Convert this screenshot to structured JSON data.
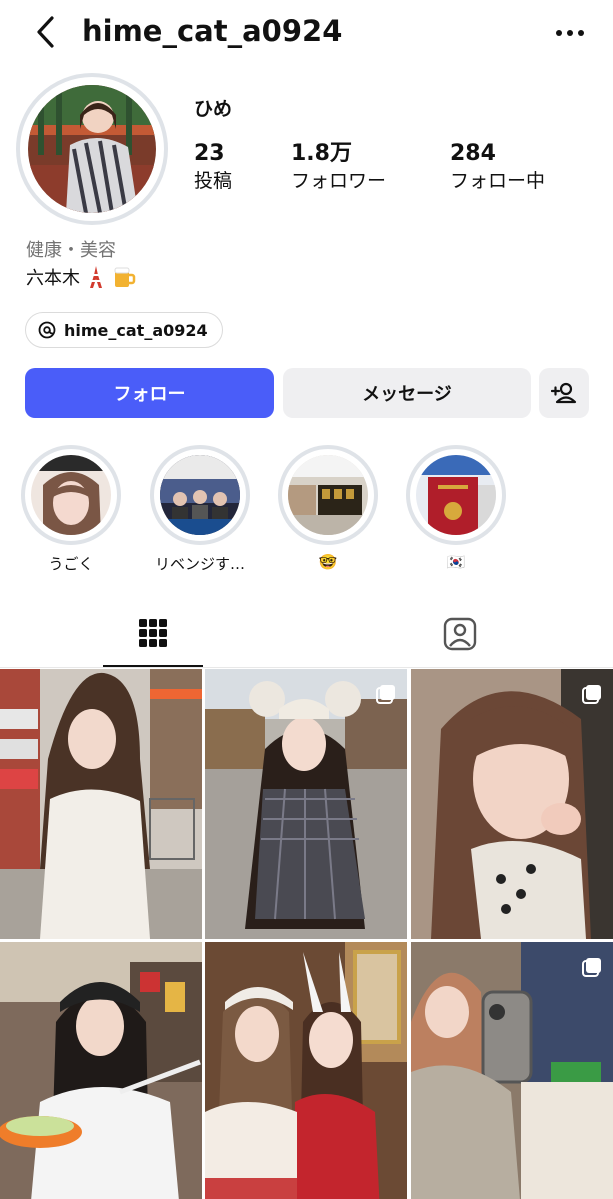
{
  "header": {
    "username": "hime_cat_a0924",
    "back_icon": "chevron-left-icon",
    "more_icon": "more-horizontal-icon"
  },
  "profile": {
    "display_name": "ひめ",
    "stats": [
      {
        "value": "23",
        "label": "投稿"
      },
      {
        "value": "1.8万",
        "label": "フォロワー"
      },
      {
        "value": "284",
        "label": "フォロー中"
      }
    ],
    "category": "健康・美容",
    "bio": "六本木",
    "bio_emojis": [
      "tower-icon",
      "beer-icon"
    ],
    "threads_handle": "hime_cat_a0924"
  },
  "actions": {
    "follow_label": "フォロー",
    "message_label": "メッセージ",
    "add_user_icon": "add-user-icon"
  },
  "colors": {
    "follow_button": "#4a5df9",
    "secondary_button": "#efeff1",
    "ring": "#dfe3e8"
  },
  "highlights": [
    {
      "label": "うごく"
    },
    {
      "label": "リベンジす…"
    },
    {
      "label": "🤓"
    },
    {
      "label": "🇰🇷"
    }
  ],
  "tabs": [
    {
      "icon": "grid-icon",
      "selected": true
    },
    {
      "icon": "tagged-icon",
      "selected": false
    }
  ],
  "posts": [
    {
      "multi": false
    },
    {
      "multi": true
    },
    {
      "multi": true
    },
    {
      "multi": true
    },
    {
      "multi": false
    },
    {
      "multi": true
    }
  ]
}
